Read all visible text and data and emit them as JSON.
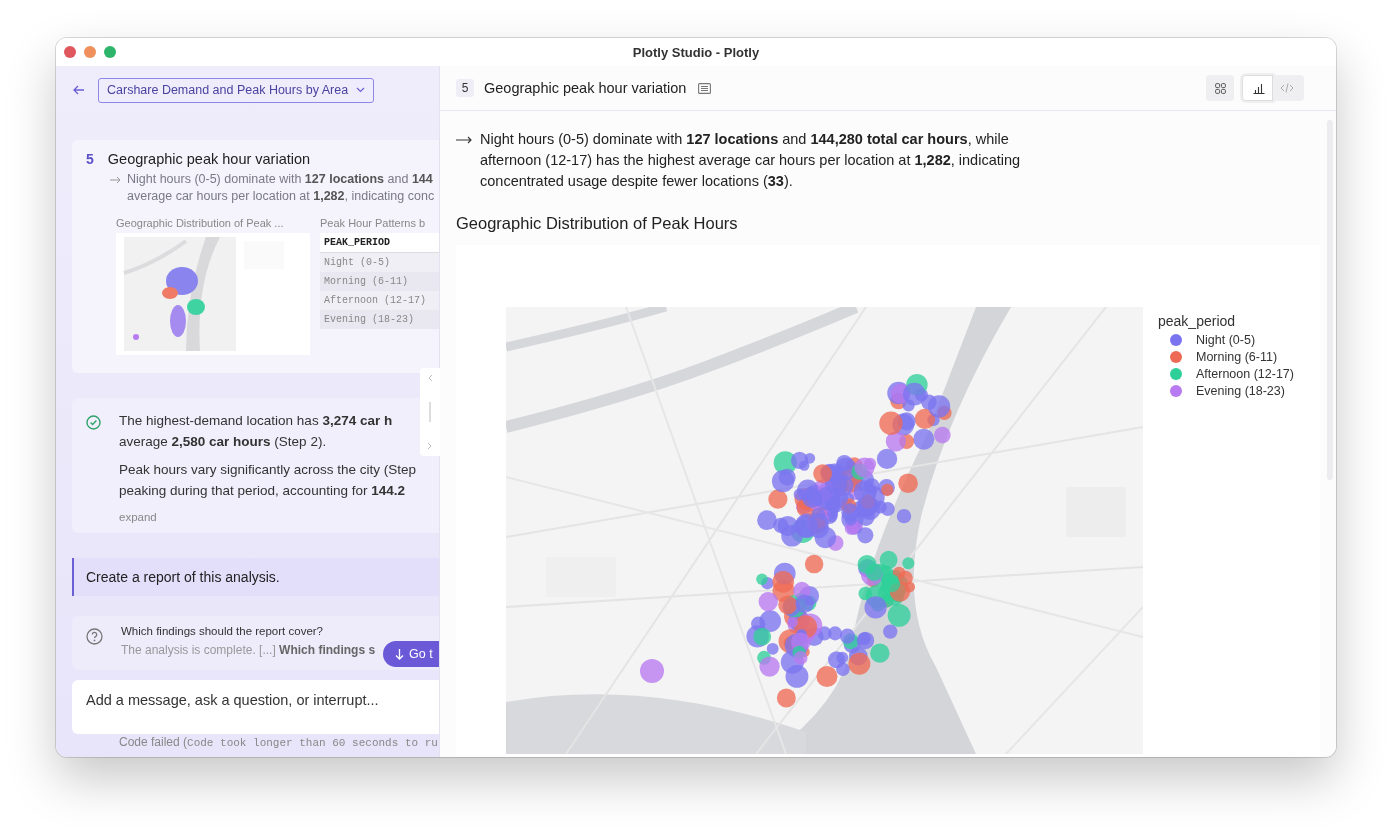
{
  "window": {
    "title": "Plotly Studio - Plotly"
  },
  "left": {
    "project_select": {
      "value": "Carshare Demand and Peak Hours by Area"
    },
    "step": {
      "number": "5",
      "title": "Geographic peak hour variation",
      "summary_lines": [
        "Night hours (0-5) dominate with **127 locations** and **144**",
        "average car hours per location at **1,282**, indicating conc"
      ],
      "map_thumb_title": "Geographic Distribution of Peak ...",
      "table_thumb": {
        "title": "Peak Hour Patterns b",
        "header": "PEAK_PERIOD",
        "rows": [
          "Night (0-5)",
          "Morning (6-11)",
          "Afternoon (12-17)",
          "Evening (18-23)"
        ]
      }
    },
    "finding": {
      "completed": true,
      "paragraphs": [
        [
          "The highest-demand location has **3,274 car h**",
          "average **2,580 car hours** (Step 2)."
        ],
        [
          "Peak hours vary significantly across the city (Step",
          "peaking during that period, accounting for **144.2**"
        ]
      ],
      "expand": "expand"
    },
    "user_message": "Create a report of this analysis.",
    "question": {
      "title": "Which findings should the report cover?",
      "preview": "The analysis is complete. [...] **Which findings s**",
      "button": "Go t"
    },
    "input": {
      "placeholder": "Add a message, ask a question, or interrupt..."
    },
    "log_line": {
      "label": "Code failed (",
      "code": "Code took longer than 60 seconds to ru"
    }
  },
  "right": {
    "panel": {
      "step_number": "5",
      "title": "Geographic peak hour variation",
      "view_buttons": [
        {
          "kind": "grid",
          "selected": false
        },
        {
          "kind": "chart",
          "selected": true
        },
        {
          "kind": "code",
          "selected": false
        }
      ],
      "summary": "Night hours (0-5) dominate with **127 locations** and **144,280 total car hours**, while afternoon (12-17) has the highest average car hours per location at **1,282**, indicating concentrated usage despite fewer locations (**33**).",
      "chart_title": "Geographic Distribution of Peak Hours",
      "legend": {
        "title": "peak_period",
        "items": [
          {
            "label": "Night (0-5)",
            "color": "#7b74f0"
          },
          {
            "label": "Morning (6-11)",
            "color": "#ef6a55"
          },
          {
            "label": "Afternoon (12-17)",
            "color": "#2fcf9a"
          },
          {
            "label": "Evening (18-23)",
            "color": "#b77af0"
          }
        ]
      }
    }
  }
}
